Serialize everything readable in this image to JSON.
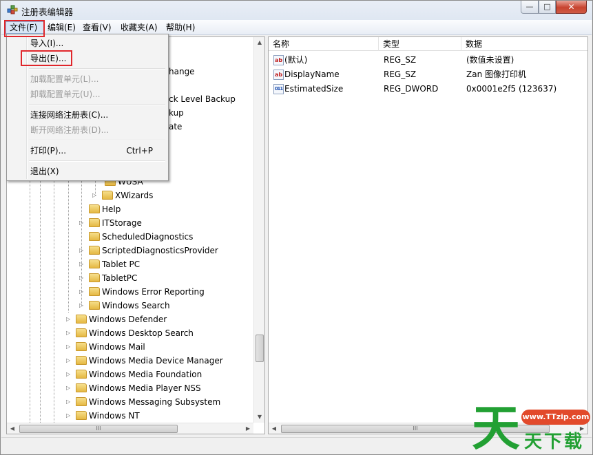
{
  "window": {
    "title": "注册表编辑器",
    "minimize": "—",
    "maximize": "□",
    "close": "✕"
  },
  "menubar": [
    {
      "label": "文件(F)"
    },
    {
      "label": "编辑(E)"
    },
    {
      "label": "查看(V)"
    },
    {
      "label": "收藏夹(A)"
    },
    {
      "label": "帮助(H)"
    }
  ],
  "file_menu": {
    "import": "导入(I)...",
    "export": "导出(E)...",
    "load_hive": "加载配置单元(L)...",
    "unload_hive": "卸载配置单元(U)...",
    "connect": "连接网络注册表(C)...",
    "disconnect": "断开网络注册表(D)...",
    "print": "打印(P)...",
    "print_shortcut": "Ctrl+P",
    "exit": "退出(X)"
  },
  "tree": {
    "partial": [
      "hange",
      "ck Level Backup",
      "kup",
      "ate",
      "WUSA"
    ],
    "items": [
      {
        "label": "XWizards"
      },
      {
        "label": "Help"
      },
      {
        "label": "ITStorage"
      },
      {
        "label": "ScheduledDiagnostics"
      },
      {
        "label": "ScriptedDiagnosticsProvider"
      },
      {
        "label": "Tablet PC"
      },
      {
        "label": "TabletPC"
      },
      {
        "label": "Windows Error Reporting"
      },
      {
        "label": "Windows Search"
      },
      {
        "label": "Windows Defender"
      },
      {
        "label": "Windows Desktop Search"
      },
      {
        "label": "Windows Mail"
      },
      {
        "label": "Windows Media Device Manager"
      },
      {
        "label": "Windows Media Foundation"
      },
      {
        "label": "Windows Media Player NSS"
      },
      {
        "label": "Windows Messaging Subsystem"
      },
      {
        "label": "Windows NT"
      }
    ]
  },
  "list": {
    "columns": {
      "name": "名称",
      "type": "类型",
      "data": "数据"
    },
    "rows": [
      {
        "name": "(默认)",
        "type": "REG_SZ",
        "data": "(数值未设置)",
        "icon": "ab"
      },
      {
        "name": "DisplayName",
        "type": "REG_SZ",
        "data": "Zan 图像打印机",
        "icon": "ab"
      },
      {
        "name": "EstimatedSize",
        "type": "REG_DWORD",
        "data": "0x0001e2f5 (123637)",
        "icon": "011"
      }
    ]
  },
  "scroll_glyphs": {
    "up": "▲",
    "down": "▼",
    "left": "◀",
    "right": "▶",
    "grip": "III"
  },
  "watermark": {
    "char": "天",
    "site": "www.TTzip.com",
    "text": "天下载"
  }
}
